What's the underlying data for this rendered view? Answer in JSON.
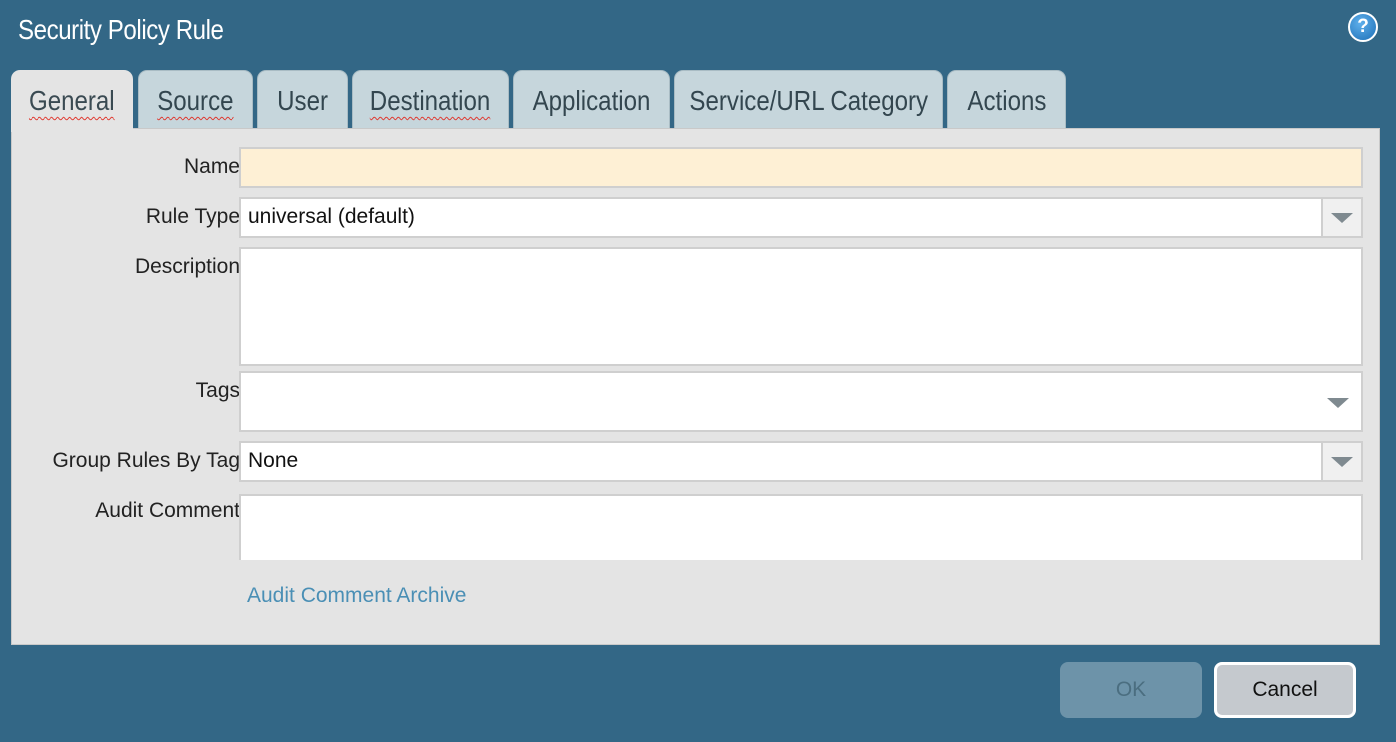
{
  "window": {
    "title": "Security Policy Rule",
    "help_icon": "question-mark-icon"
  },
  "tabs": [
    {
      "label": "General"
    },
    {
      "label": "Source"
    },
    {
      "label": "User"
    },
    {
      "label": "Destination"
    },
    {
      "label": "Application"
    },
    {
      "label": "Service/URL Category"
    },
    {
      "label": "Actions"
    }
  ],
  "active_tab": "General",
  "form": {
    "name": {
      "label": "Name",
      "value": ""
    },
    "rule_type": {
      "label": "Rule Type",
      "value": "universal (default)"
    },
    "description": {
      "label": "Description",
      "value": ""
    },
    "tags": {
      "label": "Tags",
      "value": ""
    },
    "group_rules_by_tag": {
      "label": "Group Rules By Tag",
      "value": "None"
    },
    "audit_comment": {
      "label": "Audit Comment",
      "value": ""
    }
  },
  "links": {
    "audit_comment_archive": "Audit Comment Archive"
  },
  "buttons": {
    "ok": "OK",
    "cancel": "Cancel"
  },
  "colors": {
    "dialog_bg": "#336786",
    "panel_bg": "#e4e4e4",
    "inactive_tab": "#c6d6dc",
    "required_field": "#fef0d5",
    "link": "#4a8fb5",
    "ok_disabled": "#6d93a9"
  }
}
